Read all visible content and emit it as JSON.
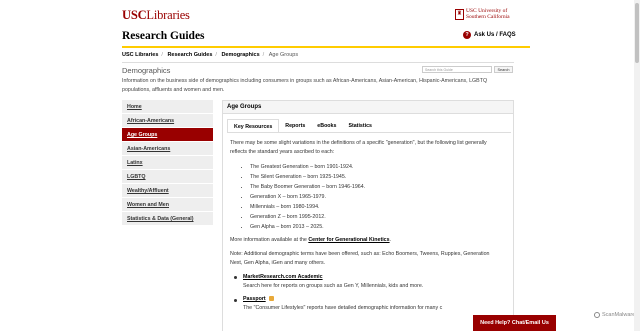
{
  "header": {
    "logo_usc": "USC",
    "logo_lib": "Libraries",
    "seal_line1": "USC University of",
    "seal_line2": "Southern California",
    "site_title": "Research Guides",
    "askus": "Ask Us / FAQS",
    "askus_icon": "?"
  },
  "breadcrumb": [
    "USC Libraries",
    "Research Guides",
    "Demographics",
    "Age Groups"
  ],
  "guide": {
    "title": "Demographics",
    "description": "Information on the business side of demographics including consumers in groups such as African-Americans, Asian-American, Hispanic-Americans, LGBTQ populations, affluents and women and men."
  },
  "search": {
    "placeholder": "Search this Guide",
    "button": "Search"
  },
  "sidebar": [
    {
      "label": "Home",
      "active": false
    },
    {
      "label": "African-Americans",
      "active": false
    },
    {
      "label": "Age Groups",
      "active": true
    },
    {
      "label": "Asian-Americans",
      "active": false
    },
    {
      "label": "Latinx",
      "active": false
    },
    {
      "label": "LGBTQ",
      "active": false
    },
    {
      "label": "Wealthy/Affluent",
      "active": false
    },
    {
      "label": "Women and Men",
      "active": false
    },
    {
      "label": "Statistics & Data (General)",
      "active": false
    }
  ],
  "box": {
    "heading": "Age Groups",
    "tabs": [
      "Key Resources",
      "Reports",
      "eBooks",
      "Statistics"
    ],
    "intro": "There may be some slight variations in the definitions of a specific \"generation\", but the following list generally reflects the standard years ascribed to each:",
    "generations": [
      "The Greatest Generation – born 1901-1924.",
      "The Silent Generation – born 1925-1945.",
      "The Baby Boomer Generation – born 1946-1964.",
      "Generation X – born 1965-1979.",
      "Millennials – born 1980-1994.",
      "Generation Z – born 1995-2012.",
      "Gen Alpha – born 2013 – 2025."
    ],
    "more_prefix": "More information available at the ",
    "more_link": "Center for Generational Kinetics",
    "more_suffix": ".",
    "note": "Note: Additional demographic terms have been offered, such as: Echo Boomers, Tweens, Ruppies, Generation Next, Gen Alpha, iGen and many others.",
    "resources": [
      {
        "title": "MarketResearch.com Academic",
        "desc": "Search here for reports on groups such as Gen Y, Millennials, kids and more."
      },
      {
        "title": "Passport",
        "desc": "The \"Consumer Lifestyles\" reports have detailed demographic information for many c"
      }
    ]
  },
  "help_button": "Need Help? Chat/Email Us",
  "watermark": "ScanMalware"
}
